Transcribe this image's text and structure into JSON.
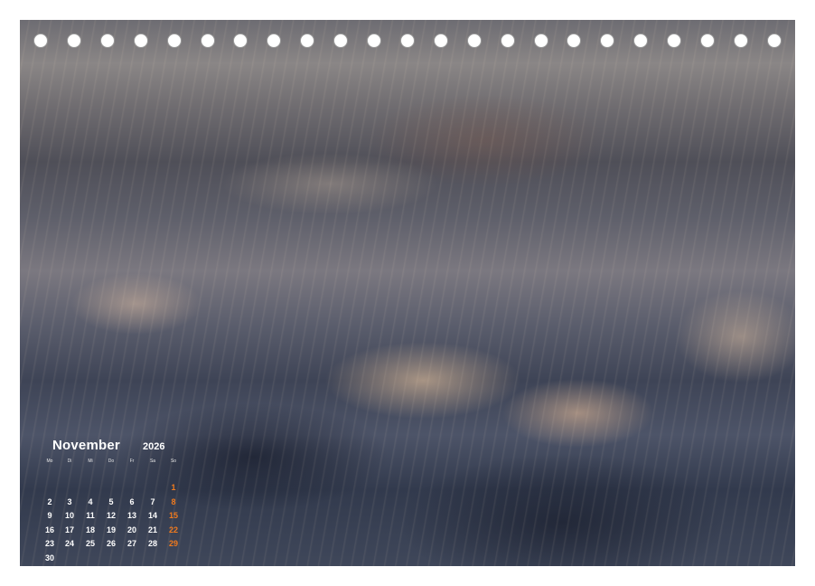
{
  "calendar": {
    "month": "November",
    "year": "2026",
    "weekday_headers": [
      "Mo",
      "Di",
      "Mi",
      "Do",
      "Fr",
      "Sa",
      "So"
    ],
    "weekend_color": "#f07a1e",
    "weeks": [
      [
        "",
        "",
        "",
        "",
        "",
        "",
        "1"
      ],
      [
        "2",
        "3",
        "4",
        "5",
        "6",
        "7",
        "8"
      ],
      [
        "9",
        "10",
        "11",
        "12",
        "13",
        "14",
        "15"
      ],
      [
        "16",
        "17",
        "18",
        "19",
        "20",
        "21",
        "22"
      ],
      [
        "23",
        "24",
        "25",
        "26",
        "27",
        "28",
        "29"
      ],
      [
        "30",
        "",
        "",
        "",
        "",
        "",
        ""
      ]
    ]
  },
  "photo": {
    "subject": "wave-splash-photo"
  },
  "binding": {
    "hole_count": 23
  }
}
